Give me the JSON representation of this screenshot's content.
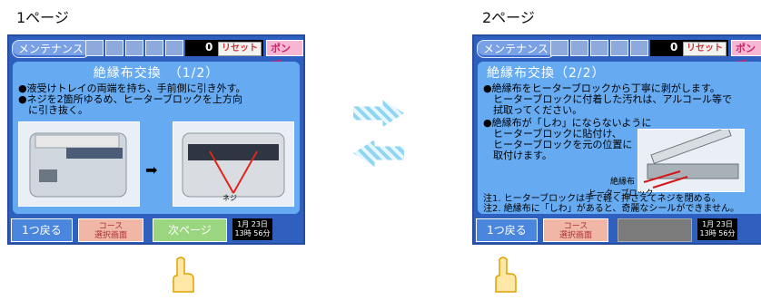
{
  "pages": [
    {
      "label": "1ページ",
      "maintenance_label": "メンテナンス",
      "counter_value": "0",
      "reset_label": "リセット",
      "pump_label": "ポンプ",
      "title": "絶縁布交換　（1/2）",
      "lines": [
        "●液受けトレイの両端を持ち、手前側に引き外す。",
        "●ネジを2箇所ゆるめ、ヒーターブロックを上方向",
        "　に引き抜く。"
      ],
      "image_labels": {
        "neji": "ネジ"
      },
      "back_label": "1つ戻る",
      "course_label_1": "コース",
      "course_label_2": "選択画面",
      "next_label": "次ページ",
      "clock_date": "1月 23日",
      "clock_time": "13時 56分"
    },
    {
      "label": "2ページ",
      "maintenance_label": "メンテナンス",
      "counter_value": "0",
      "reset_label": "リセット",
      "pump_label": "ポンプ",
      "title": "絶縁布交換（2/2）",
      "lines": [
        "●絶縁布をヒーターブロックから丁寧に剥がします。",
        "　ヒーターブロックに付着した汚れは、アルコール等で",
        "　拭取ってください。",
        "●絶縁布が「しわ」にならないように",
        "　ヒーターブロックに貼付け、",
        "　ヒーターブロックを元の位置に",
        "　取付けます。"
      ],
      "image_labels": {
        "insulator": "絶縁布",
        "heater_block": "ヒーターブロック"
      },
      "notes": [
        "注1. ヒーターブロックは手で軽く押さえてネジを閉める。",
        "注2. 絶縁布に「しわ」があると、奇麗なシールができません。"
      ],
      "back_label": "1つ戻る",
      "course_label_1": "コース",
      "course_label_2": "選択画面",
      "clock_date": "1月 23日",
      "clock_time": "13時 56分"
    }
  ]
}
